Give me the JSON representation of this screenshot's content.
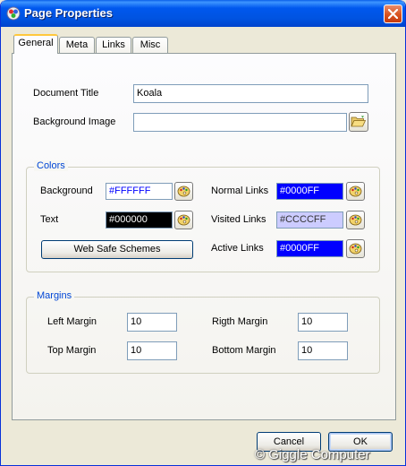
{
  "window": {
    "title": "Page Properties",
    "close_icon": "close-icon"
  },
  "tabs": [
    {
      "label": "General",
      "active": true
    },
    {
      "label": "Meta",
      "active": false
    },
    {
      "label": "Links",
      "active": false
    },
    {
      "label": "Misc",
      "active": false
    }
  ],
  "general": {
    "document_title_label": "Document Title",
    "document_title_value": "Koala",
    "background_image_label": "Background Image",
    "background_image_value": ""
  },
  "colors": {
    "group_label": "Colors",
    "background": {
      "label": "Background",
      "value": "#FFFFFF",
      "swatch": "#ffffff",
      "text_color": "#0000ff"
    },
    "text": {
      "label": "Text",
      "value": "#000000",
      "swatch": "#000000",
      "text_color": "#ffffff"
    },
    "normal_links": {
      "label": "Normal Links",
      "value": "#0000FF",
      "swatch": "#0000ff",
      "text_color": "#ffffff"
    },
    "visited_links": {
      "label": "Visited Links",
      "value": "#CCCCFF",
      "swatch": "#ccccff",
      "text_color": "#333333"
    },
    "active_links": {
      "label": "Active Links",
      "value": "#0000FF",
      "swatch": "#0000ff",
      "text_color": "#ffffff"
    },
    "web_safe_button": "Web Safe Schemes"
  },
  "margins": {
    "group_label": "Margins",
    "left": {
      "label": "Left Margin",
      "value": "10"
    },
    "right": {
      "label": "Rigth Margin",
      "value": "10"
    },
    "top": {
      "label": "Top Margin",
      "value": "10"
    },
    "bottom": {
      "label": "Bottom Margin",
      "value": "10"
    }
  },
  "footer": {
    "cancel_label": "Cancel",
    "ok_label": "OK"
  },
  "watermark": "© Giggle Computer"
}
